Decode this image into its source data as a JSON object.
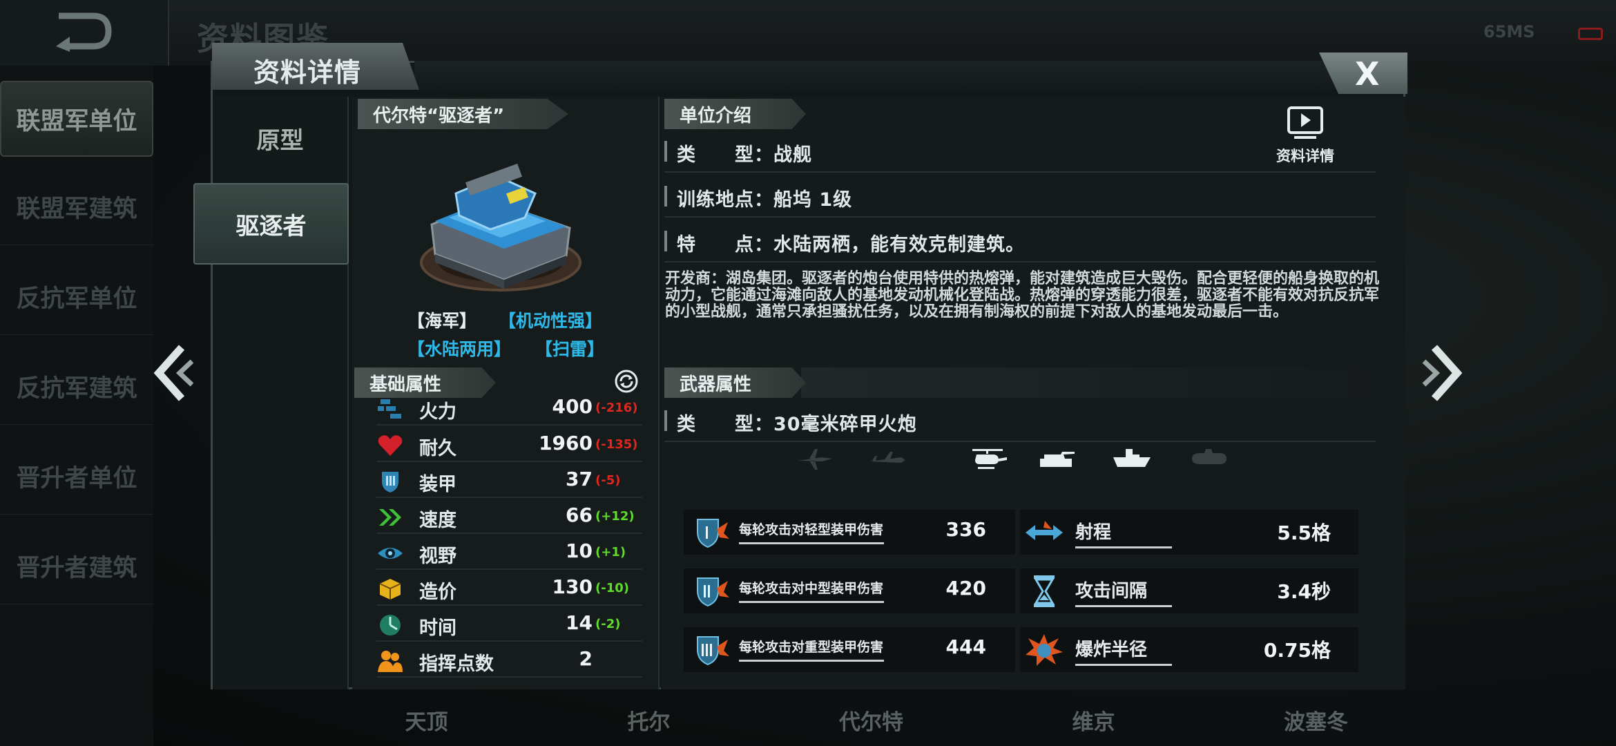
{
  "topbar": {
    "title": "资料图鉴",
    "net_status": "65MS"
  },
  "sidebar": {
    "items": [
      {
        "label": "联盟军单位",
        "active": true
      },
      {
        "label": "联盟军建筑"
      },
      {
        "label": "反抗军单位"
      },
      {
        "label": "反抗军建筑"
      },
      {
        "label": "晋升者单位"
      },
      {
        "label": "晋升者建筑"
      }
    ]
  },
  "bottom_tabs": [
    "天顶",
    "托尔",
    "代尔特",
    "维京",
    "波塞冬"
  ],
  "dialog": {
    "title": "资料详情",
    "close_label": "X",
    "types": [
      "原型",
      "驱逐者"
    ],
    "unit": {
      "name": "代尔特“驱逐者”",
      "tags": [
        {
          "text": "【海军】",
          "color": "#e8eef0"
        },
        {
          "text": "【机动性强】",
          "color": "#2fb9e8"
        },
        {
          "text": "【水陆两用】",
          "color": "#2fb9e8"
        },
        {
          "text": "【扫雷】",
          "color": "#2fb9e8"
        }
      ]
    },
    "attributes": {
      "header": "基础属性",
      "stats": [
        {
          "icon": "firepower-icon",
          "label": "火力",
          "value": "400",
          "mod": "(-216)",
          "mod_color": "#e0271f"
        },
        {
          "icon": "heart-icon",
          "label": "耐久",
          "value": "1960",
          "mod": "(-135)",
          "mod_color": "#e0271f"
        },
        {
          "icon": "armor-icon",
          "label": "装甲",
          "value": "37",
          "mod": "(-5)",
          "mod_color": "#e0271f"
        },
        {
          "icon": "speed-icon",
          "label": "速度",
          "value": "66",
          "mod": "(+12)",
          "mod_color": "#5fdc2b"
        },
        {
          "icon": "eye-icon",
          "label": "视野",
          "value": "10",
          "mod": "(+1)",
          "mod_color": "#5fdc2b"
        },
        {
          "icon": "cost-icon",
          "label": "造价",
          "value": "130",
          "mod": "(-10)",
          "mod_color": "#5fdc2b"
        },
        {
          "icon": "time-icon",
          "label": "时间",
          "value": "14",
          "mod": "(-2)",
          "mod_color": "#5fdc2b"
        },
        {
          "icon": "command-points-icon",
          "label": "指挥点数",
          "value": "2",
          "mod": "",
          "mod_color": "#5fdc2b"
        }
      ]
    },
    "intro": {
      "header": "单位介绍",
      "type": "类　　型：战舰",
      "training": "训练地点：船坞 1级",
      "feature": "特　　点：水陆两栖，能有效克制建筑。",
      "detail_button": "资料详情",
      "description": "开发商：湖岛集团。驱逐者的炮台使用特供的热熔弹，能对建筑造成巨大毁伤。配合更轻便的船身换取的机动力，它能通过海滩向敌人的基地发动机械化登陆战。热熔弹的穿透能力很差，驱逐者不能有效对抗反抗军的小型战舰，通常只承担骚扰任务，以及在拥有制海权的前提下对敌人的基地发动最后一击。"
    },
    "weapon": {
      "header": "武器属性",
      "type": "类　　型：30毫米碎甲火炮",
      "targets": [
        {
          "name": "fighter-jet-icon",
          "active": false
        },
        {
          "name": "bomber-icon",
          "active": false
        },
        {
          "name": "helicopter-icon",
          "active": true
        },
        {
          "name": "tank-icon",
          "active": true
        },
        {
          "name": "ship-icon",
          "active": true
        },
        {
          "name": "submarine-icon",
          "active": false
        }
      ],
      "damage": [
        {
          "label": "每轮攻击对轻型装甲伤害",
          "value": "336",
          "icon": "light-armor-icon"
        },
        {
          "label": "每轮攻击对中型装甲伤害",
          "value": "420",
          "icon": "medium-armor-icon"
        },
        {
          "label": "每轮攻击对重型装甲伤害",
          "value": "444",
          "icon": "heavy-armor-icon"
        }
      ],
      "props": [
        {
          "label": "射程",
          "value": "5.5格",
          "icon": "range-icon"
        },
        {
          "label": "攻击间隔",
          "value": "3.4秒",
          "icon": "hourglass-icon"
        },
        {
          "label": "爆炸半径",
          "value": "0.75格",
          "icon": "explosion-icon"
        }
      ]
    }
  }
}
